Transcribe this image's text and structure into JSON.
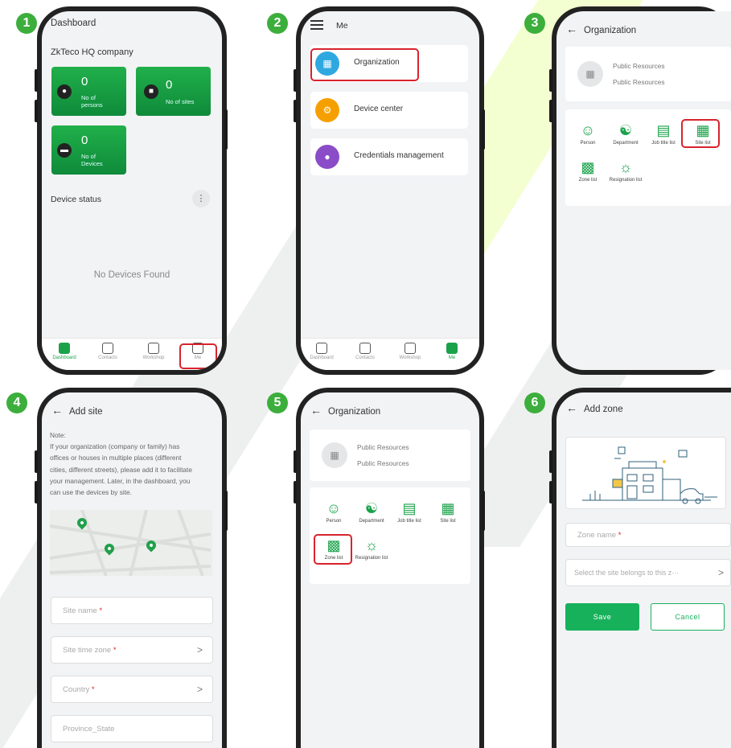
{
  "steps": [
    "1",
    "2",
    "3",
    "4",
    "5",
    "6"
  ],
  "colors": {
    "brand_green": "#1aa24a",
    "highlight_red": "#d9232d",
    "badge_green": "#3cae3c"
  },
  "screen1": {
    "title": "Dashboard",
    "company": "ZkTeco HQ company",
    "tiles": [
      {
        "value": "0",
        "label_line1": "No of",
        "label_line2": "persons",
        "icon": "person-icon"
      },
      {
        "value": "0",
        "label_line1": "No of sites",
        "label_line2": "",
        "icon": "building-icon"
      },
      {
        "value": "0",
        "label_line1": "No of",
        "label_line2": "Devices",
        "icon": "device-icon"
      }
    ],
    "device_status": "Device status",
    "more_icon": "⋮",
    "empty_text": "No Devices Found",
    "tabs": [
      "Dashboard",
      "Contacts",
      "Workshop",
      "Me"
    ],
    "active_tab": "Dashboard"
  },
  "screen2": {
    "title": "Me",
    "items": [
      "Organization",
      "Device center",
      "Credentials management"
    ],
    "tabs": [
      "Dashboard",
      "Contacts",
      "Workshop",
      "Me"
    ],
    "active_tab": "Me"
  },
  "screen3": {
    "title": "Organization",
    "resource_line1": "Public Resources",
    "resource_line2": "Public Resources",
    "grid": [
      {
        "label": "Person",
        "icon": "person-icon"
      },
      {
        "label": "Department",
        "icon": "department-icon"
      },
      {
        "label": "Job title list",
        "icon": "briefcase-icon"
      },
      {
        "label": "Site list",
        "icon": "building-icon"
      },
      {
        "label": "Zone list",
        "icon": "zone-icon"
      },
      {
        "label": "Resignation list",
        "icon": "resignation-icon"
      }
    ]
  },
  "screen4": {
    "title": "Add site",
    "note_title": "Note:",
    "note_lines": [
      "If your organization (company or family) has",
      "offices or houses in multiple places (different",
      "cities, different streets), please add it to facilitate",
      "your management. Later, in the dashboard, you",
      "can use the devices by site."
    ],
    "fields": [
      {
        "placeholder": "Site name",
        "required": "*",
        "chevron": ""
      },
      {
        "placeholder": "Site time zone",
        "required": "*",
        "chevron": ">"
      },
      {
        "placeholder": "Country",
        "required": "*",
        "chevron": ">"
      },
      {
        "placeholder": "Province_State",
        "required": "",
        "chevron": ""
      }
    ]
  },
  "screen5": {
    "title": "Organization",
    "resource_line1": "Public Resources",
    "resource_line2": "Public Resources",
    "grid": [
      {
        "label": "Person",
        "icon": "person-icon"
      },
      {
        "label": "Department",
        "icon": "department-icon"
      },
      {
        "label": "Job title list",
        "icon": "briefcase-icon"
      },
      {
        "label": "Site list",
        "icon": "building-icon"
      },
      {
        "label": "Zone list",
        "icon": "zone-icon"
      },
      {
        "label": "Resignation list",
        "icon": "resignation-icon"
      }
    ]
  },
  "screen6": {
    "title": "Add zone",
    "zone_name_placeholder": "Zone name",
    "zone_name_required": "*",
    "site_select_placeholder": "Select the site belongs to this z···",
    "chevron": ">",
    "save_label": "Save",
    "cancel_label": "Cancel"
  }
}
